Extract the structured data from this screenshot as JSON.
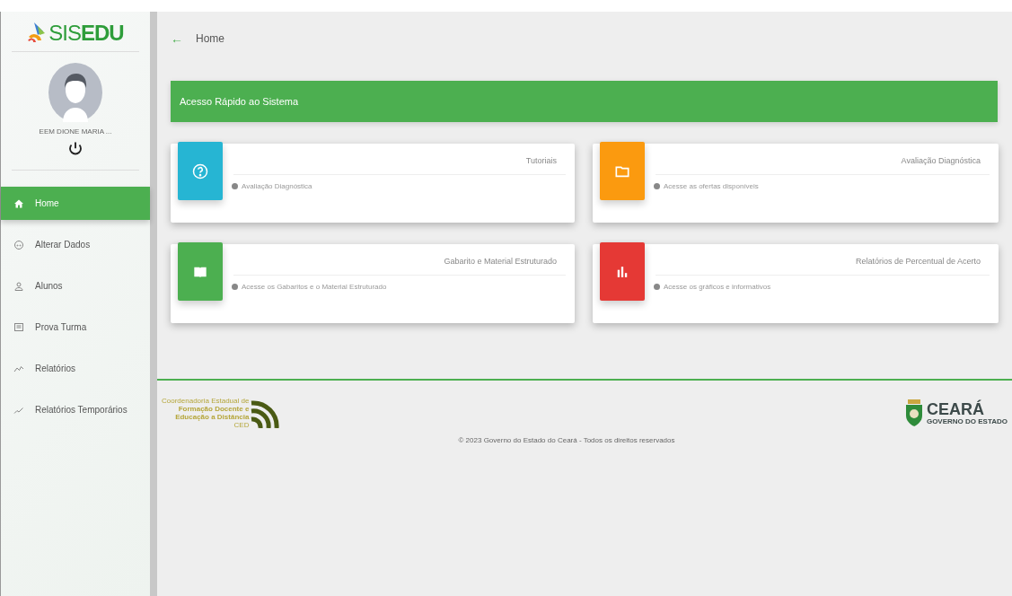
{
  "sidebar": {
    "logo": "SIS**EDU**",
    "user": {
      "name": "EEM DIONE MARIA ..."
    },
    "items": [
      {
        "label": "Home",
        "kind": "home",
        "selected": true
      },
      {
        "label": "Alterar Dados",
        "kind": "face",
        "selected": false
      },
      {
        "label": "Alunos",
        "kind": "person",
        "selected": false
      },
      {
        "label": "Prova Turma",
        "kind": "note",
        "selected": false
      },
      {
        "label": "Relatórios",
        "kind": "line",
        "selected": false
      },
      {
        "label": "Relatórios Temporários",
        "kind": "trend",
        "selected": false
      }
    ]
  },
  "header": {
    "back": "←",
    "title": "Home"
  },
  "banner": "Acesso Rápido ao Sistema",
  "cards": [
    {
      "title": "Tutoriais",
      "subtitle": "Avaliação Diagnóstica",
      "kind": "help",
      "color": "#26b5d3"
    },
    {
      "title": "Avaliação Diagnóstica",
      "subtitle": "Acesse as ofertas disponíveis",
      "kind": "folder",
      "color": "#fb9a0f"
    },
    {
      "title": "Gabarito e Material Estruturado",
      "subtitle": "Acesse os Gabaritos e o Material Estruturado",
      "kind": "book",
      "color": "#4caf50"
    },
    {
      "title": "Relatórios de Percentual de Acerto",
      "subtitle": "Acesse os gráficos e informativos",
      "kind": "chart",
      "color": "#e53935"
    }
  ],
  "footer": {
    "ced": [
      "Coordenadoria Estadual de",
      "Formação Docente e",
      "Educação a Distância",
      "CED"
    ],
    "ceara": [
      "CEARÁ",
      "GOVERNO DO ESTADO"
    ],
    "copyright": "© 2023 Governo do Estado do Ceará - Todos os direitos reservados"
  }
}
